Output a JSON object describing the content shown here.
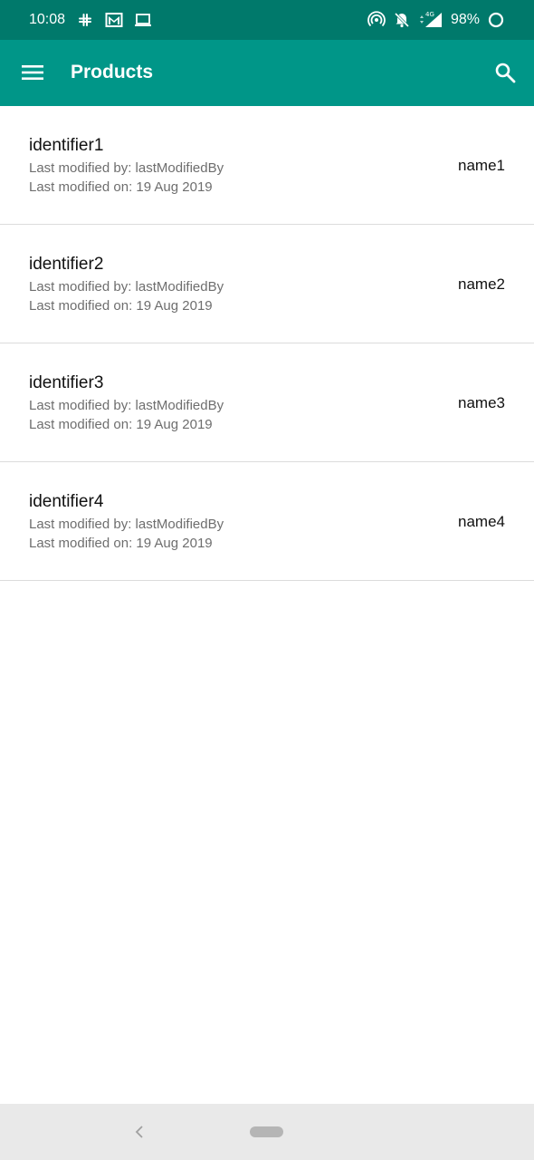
{
  "status_bar": {
    "time": "10:08",
    "battery": "98%",
    "network": "4G",
    "left_icons": [
      "slack-icon",
      "gmail-icon",
      "laptop-icon"
    ],
    "right_icons": [
      "hotspot-icon",
      "bell-off-icon",
      "signal-icon",
      "battery-icon"
    ]
  },
  "app_bar": {
    "title": "Products",
    "background": "#009688",
    "status_background": "#00796b"
  },
  "products": [
    {
      "identifier": "identifier1",
      "modified_by": "Last modified by: lastModifiedBy",
      "modified_on": "Last modified on: 19 Aug 2019",
      "name": "name1"
    },
    {
      "identifier": "identifier2",
      "modified_by": "Last modified by: lastModifiedBy",
      "modified_on": "Last modified on: 19 Aug 2019",
      "name": "name2"
    },
    {
      "identifier": "identifier3",
      "modified_by": "Last modified by: lastModifiedBy",
      "modified_on": "Last modified on: 19 Aug 2019",
      "name": "name3"
    },
    {
      "identifier": "identifier4",
      "modified_by": "Last modified by: lastModifiedBy",
      "modified_on": "Last modified on: 19 Aug 2019",
      "name": "name4"
    }
  ],
  "nav_bar": {
    "icons": [
      "back-icon",
      "home-pill-icon"
    ]
  }
}
